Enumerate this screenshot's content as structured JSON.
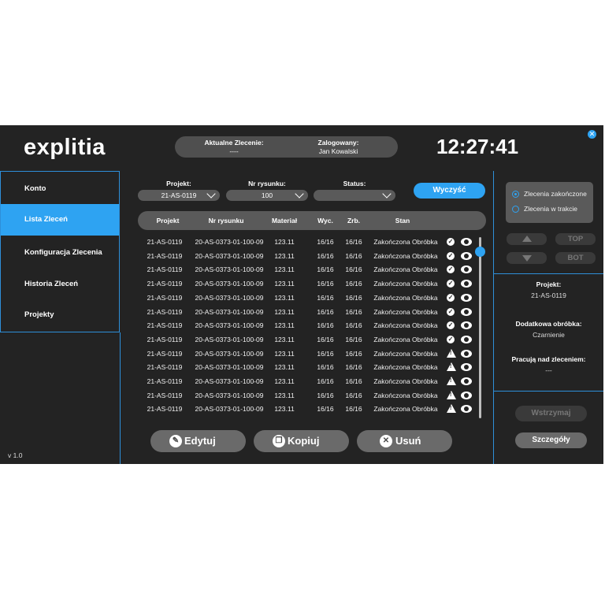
{
  "header": {
    "logo": "explitia",
    "current_order_label": "Aktualne Zlecenie:",
    "current_order_value": "----",
    "logged_in_label": "Zalogowany:",
    "logged_in_value": "Jan Kowalski",
    "clock": "12:27:41"
  },
  "sidebar": {
    "items": [
      {
        "label": "Konto"
      },
      {
        "label": "Lista Zleceń"
      },
      {
        "label": "Konfiguracja Zlecenia"
      },
      {
        "label": "Historia Zleceń"
      },
      {
        "label": "Projekty"
      }
    ],
    "active_index": 1,
    "version": "v 1.0"
  },
  "filters": {
    "project_label": "Projekt:",
    "project_value": "21-AS-0119",
    "drawing_label": "Nr rysunku:",
    "drawing_value": "100",
    "status_label": "Status:",
    "status_value": "",
    "clear_label": "Wyczyść"
  },
  "table": {
    "columns": [
      "Projekt",
      "Nr rysunku",
      "Materiał",
      "Wyc.",
      "Zrb.",
      "Stan"
    ],
    "rows": [
      {
        "project": "21-AS-0119",
        "drawing": "20-AS-0373-01-100-09",
        "material": "123.11",
        "cut": "16/16",
        "done": "16/16",
        "state": "Zakończona Obróbka",
        "icon": "ok"
      },
      {
        "project": "21-AS-0119",
        "drawing": "20-AS-0373-01-100-09",
        "material": "123.11",
        "cut": "16/16",
        "done": "16/16",
        "state": "Zakończona Obróbka",
        "icon": "ok"
      },
      {
        "project": "21-AS-0119",
        "drawing": "20-AS-0373-01-100-09",
        "material": "123.11",
        "cut": "16/16",
        "done": "16/16",
        "state": "Zakończona Obróbka",
        "icon": "ok"
      },
      {
        "project": "21-AS-0119",
        "drawing": "20-AS-0373-01-100-09",
        "material": "123.11",
        "cut": "16/16",
        "done": "16/16",
        "state": "Zakończona Obróbka",
        "icon": "ok"
      },
      {
        "project": "21-AS-0119",
        "drawing": "20-AS-0373-01-100-09",
        "material": "123.11",
        "cut": "16/16",
        "done": "16/16",
        "state": "Zakończona Obróbka",
        "icon": "ok"
      },
      {
        "project": "21-AS-0119",
        "drawing": "20-AS-0373-01-100-09",
        "material": "123.11",
        "cut": "16/16",
        "done": "16/16",
        "state": "Zakończona Obróbka",
        "icon": "ok"
      },
      {
        "project": "21-AS-0119",
        "drawing": "20-AS-0373-01-100-09",
        "material": "123.11",
        "cut": "16/16",
        "done": "16/16",
        "state": "Zakończona Obróbka",
        "icon": "ok"
      },
      {
        "project": "21-AS-0119",
        "drawing": "20-AS-0373-01-100-09",
        "material": "123.11",
        "cut": "16/16",
        "done": "16/16",
        "state": "Zakończona Obróbka",
        "icon": "ok"
      },
      {
        "project": "21-AS-0119",
        "drawing": "20-AS-0373-01-100-09",
        "material": "123.11",
        "cut": "16/16",
        "done": "16/16",
        "state": "Zakończona Obróbka",
        "icon": "warn"
      },
      {
        "project": "21-AS-0119",
        "drawing": "20-AS-0373-01-100-09",
        "material": "123.11",
        "cut": "16/16",
        "done": "16/16",
        "state": "Zakończona Obróbka",
        "icon": "warn"
      },
      {
        "project": "21-AS-0119",
        "drawing": "20-AS-0373-01-100-09",
        "material": "123.11",
        "cut": "16/16",
        "done": "16/16",
        "state": "Zakończona Obróbka",
        "icon": "warn"
      },
      {
        "project": "21-AS-0119",
        "drawing": "20-AS-0373-01-100-09",
        "material": "123.11",
        "cut": "16/16",
        "done": "16/16",
        "state": "Zakończona Obróbka",
        "icon": "warn"
      },
      {
        "project": "21-AS-0119",
        "drawing": "20-AS-0373-01-100-09",
        "material": "123.11",
        "cut": "16/16",
        "done": "16/16",
        "state": "Zakończona Obróbka",
        "icon": "warn"
      }
    ]
  },
  "actions": {
    "edit_label": "Edytuj",
    "copy_label": "Kopiuj",
    "delete_label": "Usuń"
  },
  "right_panel": {
    "radio_completed": "Zlecenia zakończone",
    "radio_in_progress": "Zlecenia w trakcie",
    "selected_radio": "completed",
    "top_label": "TOP",
    "bot_label": "BOT",
    "project_label": "Projekt:",
    "project_value": "21-AS-0119",
    "extra_label": "Dodatkowa obróbka:",
    "extra_value": "Czarnienie",
    "working_label": "Pracują nad zleceniem:",
    "working_value": "---",
    "pause_label": "Wstrzymaj",
    "details_label": "Szczegóły"
  },
  "colors": {
    "accent": "#2ea3f2",
    "background": "#232323",
    "panel": "#5a5a5a"
  }
}
